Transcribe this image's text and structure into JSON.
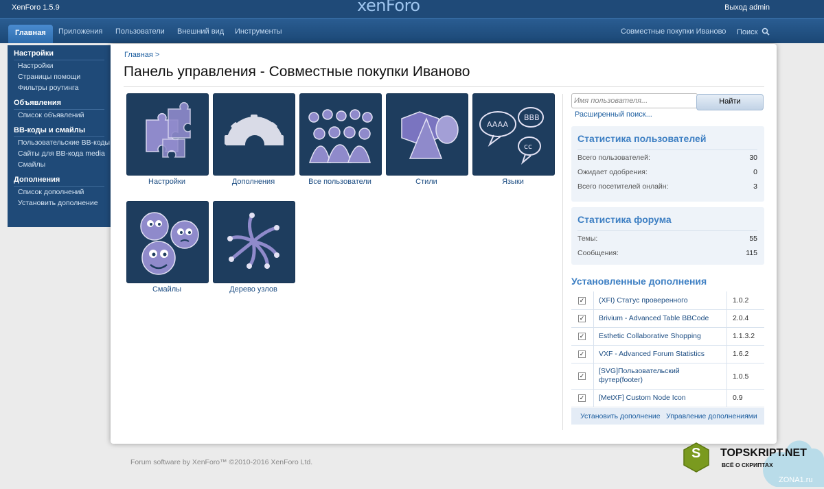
{
  "topbar": {
    "version": "XenForo 1.5.9",
    "logo": "xenForo",
    "logout": "Выход admin"
  },
  "nav": {
    "tabs": [
      "Главная",
      "Приложения",
      "Пользователи",
      "Внешний вид",
      "Инструменты"
    ],
    "forum_link": "Совместные покупки Иваново",
    "search_link": "Поиск"
  },
  "sidebar": {
    "sections": [
      {
        "title": "Настройки",
        "items": [
          "Настройки",
          "Страницы помощи",
          "Фильтры роутинга"
        ]
      },
      {
        "title": "Объявления",
        "items": [
          "Список объявлений"
        ]
      },
      {
        "title": "BB-коды и смайлы",
        "items": [
          "Пользовательские BB-коды",
          "Сайты для BB-кода media",
          "Смайлы"
        ]
      },
      {
        "title": "Дополнения",
        "items": [
          "Список дополнений",
          "Установить дополнение"
        ]
      }
    ]
  },
  "main": {
    "breadcrumb": "Главная >",
    "title": "Панель управления - Совместные покупки Иваново",
    "icons": [
      "Настройки",
      "Дополнения",
      "Все пользователи",
      "Стили",
      "Языки",
      "Смайлы",
      "Дерево узлов"
    ]
  },
  "search": {
    "placeholder": "Имя пользователя...",
    "button": "Найти",
    "advanced": "Расширенный поиск..."
  },
  "user_stats": {
    "title": "Статистика пользователей",
    "rows": [
      {
        "label": "Всего пользователей:",
        "value": "30"
      },
      {
        "label": "Ожидает одобрения:",
        "value": "0"
      },
      {
        "label": "Всего посетителей онлайн:",
        "value": "3"
      }
    ]
  },
  "forum_stats": {
    "title": "Статистика форума",
    "rows": [
      {
        "label": "Темы:",
        "value": "55"
      },
      {
        "label": "Сообщения:",
        "value": "115"
      }
    ]
  },
  "addons": {
    "title": "Установленные дополнения",
    "rows": [
      {
        "name": "(XFI) Статус проверенного",
        "version": "1.0.2",
        "checked": true
      },
      {
        "name": "Brivium - Advanced Table BBCode",
        "version": "2.0.4",
        "checked": true
      },
      {
        "name": "Esthetic Collaborative Shopping",
        "version": "1.1.3.2",
        "checked": true
      },
      {
        "name": "VXF - Advanced Forum Statistics",
        "version": "1.6.2",
        "checked": true
      },
      {
        "name": "[SVG]Пользовательский футер(footer)",
        "version": "1.0.5",
        "checked": true
      },
      {
        "name": "[MetXF] Custom Node Icon",
        "version": "0.9",
        "checked": true
      }
    ],
    "install_link": "Установить дополнение",
    "manage_link": "Управление дополнениями"
  },
  "footer": {
    "copyright": "Forum software by XenForo™ ©2010-2016 XenForo Ltd."
  },
  "watermark": {
    "brand": "TOPSKRIPT.NET",
    "tagline": "ВСЁ О СКРИПТАХ",
    "site": "ZONA1.ru",
    "badge_letter": "S"
  }
}
